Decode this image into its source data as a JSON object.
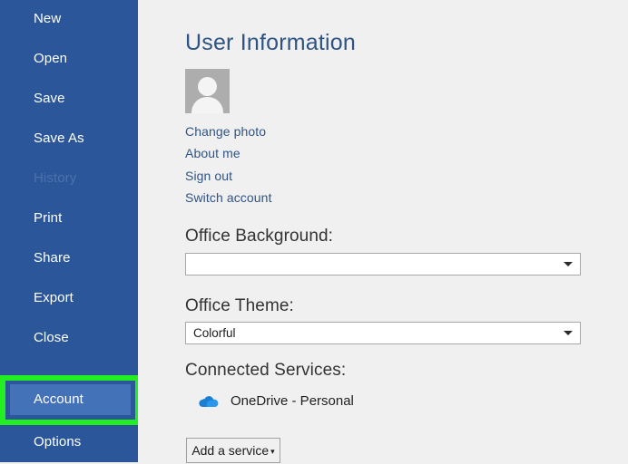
{
  "sidebar": {
    "background_color": "#2b579a",
    "selected_color": "#4472b8",
    "items": [
      {
        "label": "New",
        "state": "normal"
      },
      {
        "label": "Open",
        "state": "normal"
      },
      {
        "label": "Save",
        "state": "normal"
      },
      {
        "label": "Save As",
        "state": "normal"
      },
      {
        "label": "History",
        "state": "disabled"
      },
      {
        "label": "Print",
        "state": "normal"
      },
      {
        "label": "Share",
        "state": "normal"
      },
      {
        "label": "Export",
        "state": "normal"
      },
      {
        "label": "Close",
        "state": "normal"
      },
      {
        "label": "Account",
        "state": "selected"
      },
      {
        "label": "Options",
        "state": "normal"
      }
    ]
  },
  "annotation": {
    "highlight_color": "#22ee22",
    "target": "Account"
  },
  "main": {
    "title": "User Information",
    "avatar": {
      "icon": "person-avatar-icon",
      "background_color": "#adadad"
    },
    "account_links": [
      "Change photo",
      "About me",
      "Sign out",
      "Switch account"
    ],
    "office_background": {
      "label": "Office Background:",
      "value": ""
    },
    "office_theme": {
      "label": "Office Theme:",
      "value": "Colorful"
    },
    "connected_services": {
      "label": "Connected Services:",
      "items": [
        {
          "icon": "onedrive-cloud-icon",
          "label": "OneDrive - Personal",
          "color": "#1a7fd4"
        }
      ],
      "add_button": {
        "label": "Add a service",
        "caret": "▾"
      }
    }
  }
}
